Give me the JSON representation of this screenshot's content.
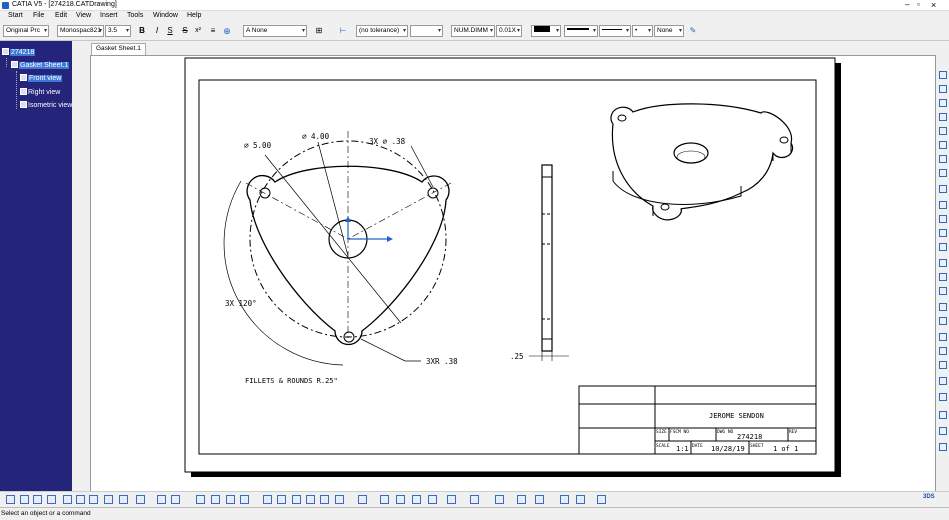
{
  "window": {
    "title": "CATIA V5 - [274218.CATDrawing]"
  },
  "menu": [
    "Start",
    "File",
    "Edit",
    "View",
    "Insert",
    "Tools",
    "Window",
    "Help"
  ],
  "toolbar": {
    "style_combo": "Original Prc",
    "font_combo": "Monospac821",
    "size_combo": "3.5",
    "bold": "B",
    "italic": "I",
    "underline": "S",
    "strike": "S",
    "superscript": "x²",
    "subscript": "x",
    "frame_combo": "A None",
    "tolerance_combo": "(no tolerance)",
    "dim_combo": "NUM.DIMM",
    "precision_combo": "0.01X",
    "none_combo": "None"
  },
  "tree": {
    "root": "274218",
    "sheet": "Gasket Sheet.1",
    "views": [
      "Front view",
      "Right view",
      "Isometric view"
    ]
  },
  "tab": {
    "label": "Gasket Sheet.1"
  },
  "drawing": {
    "dim_diam5": "∅ 5.00",
    "dim_diam4": "∅ 4.00",
    "dim_holes": "3X ∅ .38",
    "dim_angle": "3X 120°",
    "dim_radius": "3XR .38",
    "dim_thick": ".25",
    "note_fillets": "FILLETS & ROUNDS R.25\"",
    "tb_name": "JEROME SENDON",
    "tb_size_label": "SIZE",
    "tb_fscm_label": "FSCM NO",
    "tb_dwg_label": "DWG NO",
    "tb_dwg_no": "274218",
    "tb_rev_label": "REV",
    "tb_scale_label": "SCALE",
    "tb_scale": "1:1",
    "tb_date_label": "DATE",
    "tb_date": "10/28/19",
    "tb_sheet_label": "SHEET",
    "tb_sheet": "1 of 1"
  },
  "status": {
    "message": "Select an object or a command"
  },
  "colors": {
    "tree_bg": "#24247a",
    "selection": "#3e78d6",
    "axis_blue": "#1e64c8"
  }
}
